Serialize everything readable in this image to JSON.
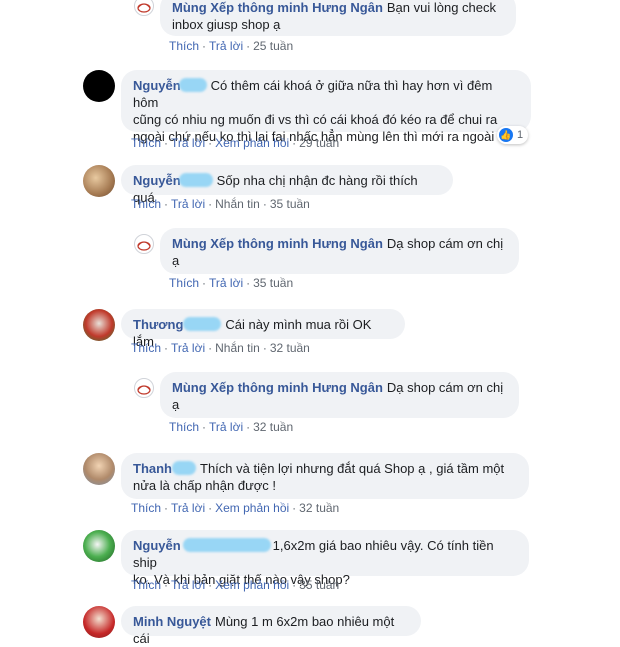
{
  "actions": {
    "like": "Thích",
    "reply": "Trả lời",
    "see_reply": "Xem phản hồi",
    "message": "Nhắn tin"
  },
  "c0": {
    "author": "Mùng Xếp thông minh Hưng Ngân",
    "line1": "Bạn vui lòng check",
    "line2": "inbox giusp shop ạ",
    "time": "25 tuần"
  },
  "c1": {
    "author": "Nguyễn",
    "line1": "Có thêm cái khoá ở giữa nữa thì hay hơn vì đêm hôm",
    "line2": "cũng có nhiu ng muốn đi vs thì có cái khoá đó kéo ra để chui ra",
    "line3": "ngoài chứ nếu ko thì lại fai nhấc hẳn mùng lên thì mới ra ngoài đc",
    "time": "29 tuần",
    "reactions": "1"
  },
  "c2": {
    "author": "Nguyễn",
    "line1": "Sốp nha chị nhận đc hàng rồi thích quá",
    "time": "35 tuần"
  },
  "c3": {
    "author": "Mùng Xếp thông minh Hưng Ngân",
    "line1": "Dạ shop cám ơn chị",
    "line2": "ạ",
    "time": "35 tuần"
  },
  "c4": {
    "author": "Thương",
    "line1": "Cái này mình mua rồi OK lắm",
    "time": "32 tuần"
  },
  "c5": {
    "author": "Mùng Xếp thông minh Hưng Ngân",
    "line1": "Dạ shop cám ơn chị",
    "line2": "ạ",
    "time": "32 tuần"
  },
  "c6": {
    "author": "Thanh",
    "line1": "Thích và tiện lợi nhưng đắt quá Shop ạ , giá tầm một",
    "line2": "nửa là chấp nhận được !",
    "time": "32 tuần"
  },
  "c7": {
    "author": "Nguyễn",
    "line1": "1,6x2m giá bao nhiêu vậy. Có tính tiền ship",
    "line2": "ko. Và khi bản giặt thế nào vậy shop?",
    "time": "35 tuần"
  },
  "c8": {
    "author": "Minh Nguyệt",
    "line1": "Mùng 1 m 6x2m bao nhiêu một cái"
  },
  "colors": {
    "link": "#385898",
    "bubble": "#f0f2f5",
    "meta": "#606770"
  }
}
